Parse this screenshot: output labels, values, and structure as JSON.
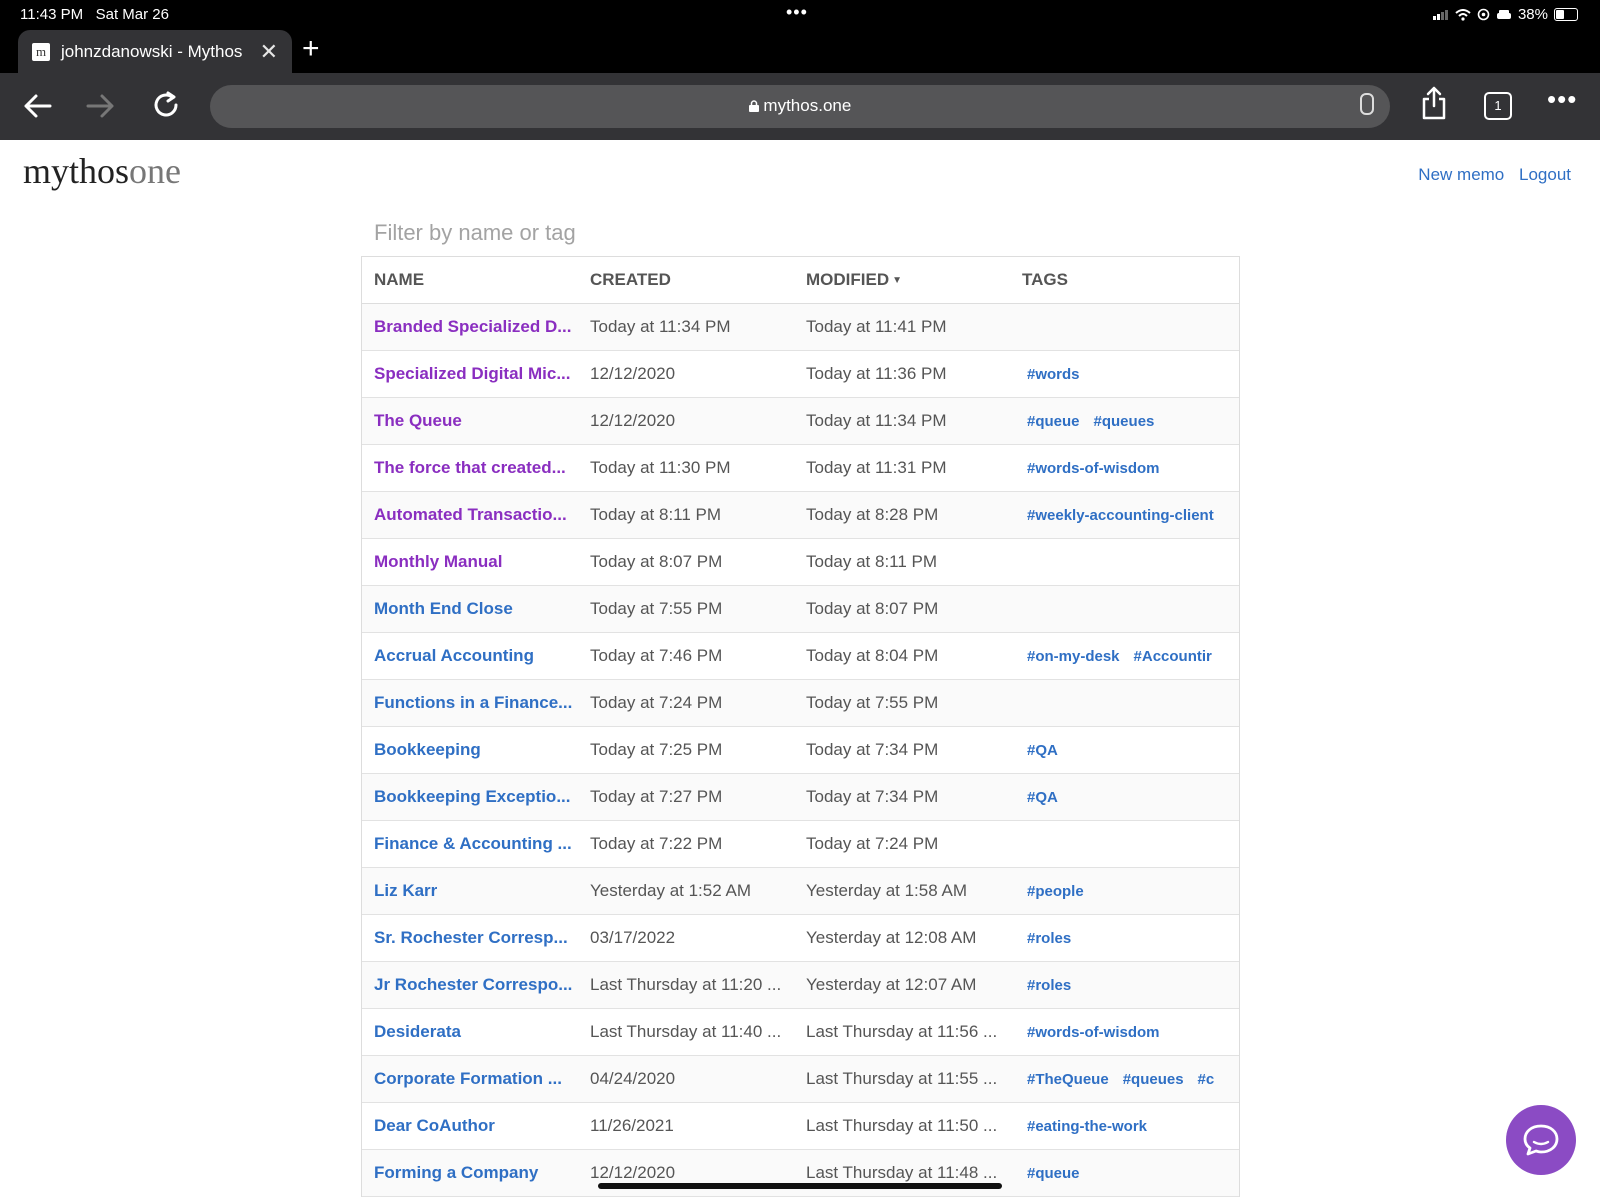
{
  "status_bar": {
    "time": "11:43 PM",
    "date": "Sat Mar 26",
    "battery": "38%"
  },
  "browser": {
    "tab_title": "johnzdanowski - Mythos",
    "favicon_letter": "m",
    "url": "mythos.one",
    "tab_count": "1"
  },
  "app": {
    "logo_main": "mythos",
    "logo_light": "one",
    "new_memo_label": "New memo",
    "logout_label": "Logout",
    "filter_placeholder": "Filter by name or tag"
  },
  "table": {
    "headers": {
      "name": "NAME",
      "created": "CREATED",
      "modified": "MODIFIED",
      "tags": "TAGS"
    },
    "sort_column": "modified",
    "colors": {
      "visited_link": "#8a2ec0",
      "link": "#2f6fc4"
    },
    "rows": [
      {
        "name": "Branded Specialized D...",
        "created": "Today at 11:34 PM",
        "modified": "Today at 11:41 PM",
        "tags": [],
        "visited": true
      },
      {
        "name": "Specialized Digital Mic...",
        "created": "12/12/2020",
        "modified": "Today at 11:36 PM",
        "tags": [
          "#words"
        ],
        "visited": true
      },
      {
        "name": "The Queue",
        "created": "12/12/2020",
        "modified": "Today at 11:34 PM",
        "tags": [
          "#queue",
          "#queues"
        ],
        "visited": true
      },
      {
        "name": "The force that created...",
        "created": "Today at 11:30 PM",
        "modified": "Today at 11:31 PM",
        "tags": [
          "#words-of-wisdom"
        ],
        "visited": true
      },
      {
        "name": "Automated Transactio...",
        "created": "Today at 8:11 PM",
        "modified": "Today at 8:28 PM",
        "tags": [
          "#weekly-accounting-client"
        ],
        "visited": true
      },
      {
        "name": "Monthly Manual",
        "created": "Today at 8:07 PM",
        "modified": "Today at 8:11 PM",
        "tags": [],
        "visited": true
      },
      {
        "name": "Month End Close",
        "created": "Today at 7:55 PM",
        "modified": "Today at 8:07 PM",
        "tags": [],
        "visited": false
      },
      {
        "name": "Accrual Accounting",
        "created": "Today at 7:46 PM",
        "modified": "Today at 8:04 PM",
        "tags": [
          "#on-my-desk",
          "#Accountir"
        ],
        "visited": false
      },
      {
        "name": "Functions in a Finance...",
        "created": "Today at 7:24 PM",
        "modified": "Today at 7:55 PM",
        "tags": [],
        "visited": false
      },
      {
        "name": "Bookkeeping",
        "created": "Today at 7:25 PM",
        "modified": "Today at 7:34 PM",
        "tags": [
          "#QA"
        ],
        "visited": false
      },
      {
        "name": "Bookkeeping Exceptio...",
        "created": "Today at 7:27 PM",
        "modified": "Today at 7:34 PM",
        "tags": [
          "#QA"
        ],
        "visited": false
      },
      {
        "name": "Finance & Accounting ...",
        "created": "Today at 7:22 PM",
        "modified": "Today at 7:24 PM",
        "tags": [],
        "visited": false
      },
      {
        "name": "Liz Karr",
        "created": "Yesterday at 1:52 AM",
        "modified": "Yesterday at 1:58 AM",
        "tags": [
          "#people"
        ],
        "visited": false
      },
      {
        "name": "Sr. Rochester Corresp...",
        "created": "03/17/2022",
        "modified": "Yesterday at 12:08 AM",
        "tags": [
          "#roles"
        ],
        "visited": false
      },
      {
        "name": "Jr Rochester Correspo...",
        "created": "Last Thursday at 11:20 ...",
        "modified": "Yesterday at 12:07 AM",
        "tags": [
          "#roles"
        ],
        "visited": false
      },
      {
        "name": "Desiderata",
        "created": "Last Thursday at 11:40 ...",
        "modified": "Last Thursday at 11:56 ...",
        "tags": [
          "#words-of-wisdom"
        ],
        "visited": false
      },
      {
        "name": "Corporate Formation ...",
        "created": "04/24/2020",
        "modified": "Last Thursday at 11:55 ...",
        "tags": [
          "#TheQueue",
          "#queues",
          "#c"
        ],
        "visited": false
      },
      {
        "name": "Dear CoAuthor",
        "created": "11/26/2021",
        "modified": "Last Thursday at 11:50 ...",
        "tags": [
          "#eating-the-work"
        ],
        "visited": false
      },
      {
        "name": "Forming a Company",
        "created": "12/12/2020",
        "modified": "Last Thursday at 11:48 ...",
        "tags": [
          "#queue"
        ],
        "visited": false
      }
    ]
  },
  "icons": {
    "back": "back-arrow-icon",
    "forward": "forward-arrow-icon",
    "reload": "reload-icon",
    "lock": "lock-icon",
    "mic": "microphone-icon",
    "share": "share-icon",
    "tabs": "tabs-icon",
    "more": "more-icon",
    "chat": "chat-icon",
    "accent": "#8b4bc4"
  }
}
